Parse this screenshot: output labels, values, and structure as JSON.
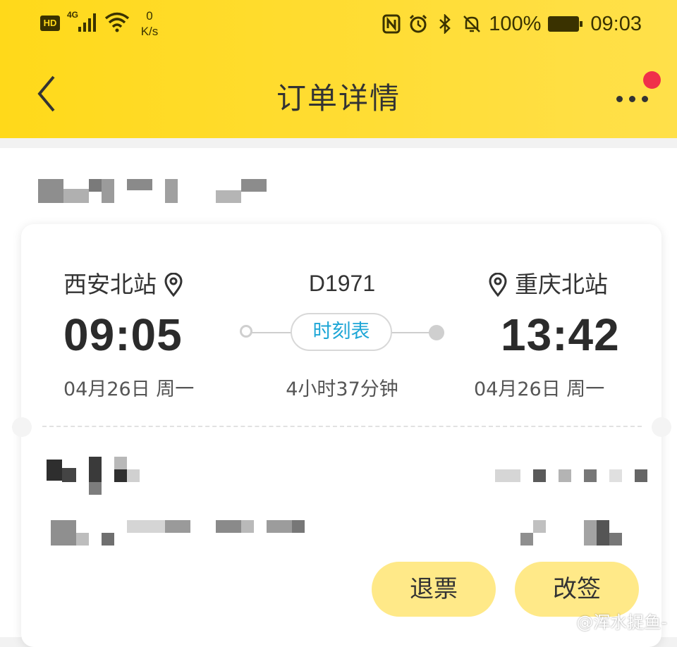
{
  "status_bar": {
    "hd": "HD",
    "network": "4G",
    "speed_value": "0",
    "speed_unit": "K/s",
    "battery": "100%",
    "time": "09:03",
    "icons": [
      "nfc-icon",
      "alarm-icon",
      "bluetooth-icon",
      "mute-icon",
      "battery-charging-icon"
    ]
  },
  "nav": {
    "title": "订单详情",
    "back_icon": "chevron-left-icon",
    "more_icon": "more-dots-icon",
    "badge_color": "#f0304a"
  },
  "trip": {
    "from_station": "西安北站",
    "to_station": "重庆北站",
    "train_number": "D1971",
    "depart_time": "09:05",
    "arrive_time": "13:42",
    "depart_date": "04月26日 周一",
    "arrive_date": "04月26日 周一",
    "duration": "4小时37分钟",
    "schedule_label": "时刻表"
  },
  "actions": {
    "refund_label": "退票",
    "change_label": "改签"
  },
  "watermark": "@浑水捉鱼-",
  "colors": {
    "header_yellow": "#ffd91a",
    "button_yellow": "#ffe988",
    "link_blue": "#1da6d6"
  }
}
